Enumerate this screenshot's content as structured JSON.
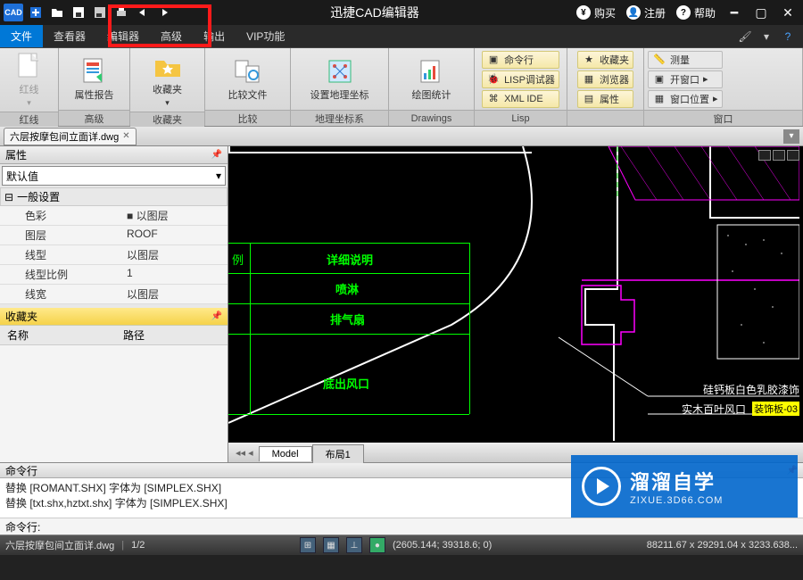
{
  "titlebar": {
    "logo": "CAD",
    "title": "迅捷CAD编辑器",
    "buy": "购买",
    "register": "注册",
    "help": "帮助"
  },
  "menu": {
    "tabs": [
      "文件",
      "查看器",
      "编辑器",
      "高级",
      "输出",
      "VIP功能"
    ]
  },
  "ribbon": {
    "g0": {
      "big": "红线",
      "drop": "红线",
      "label": "红线"
    },
    "g1": {
      "big": "属性报告",
      "label": "高级"
    },
    "g2": {
      "big": "收藏夹",
      "label": "收藏夹"
    },
    "g3": {
      "big": "比较文件",
      "label": "比较"
    },
    "g4": {
      "big": "设置地理坐标",
      "label": "地理坐标系"
    },
    "g5": {
      "big": "绘图统计",
      "label": "Drawings"
    },
    "g6": {
      "s0": "命令行",
      "s1": "LISP调试器",
      "s2": "XML IDE",
      "label": "Lisp"
    },
    "g7": {
      "s0": "收藏夹",
      "s1": "浏览器",
      "s2": "属性",
      "label": ""
    },
    "g8": {
      "s0": "测量",
      "s1": "开窗口",
      "s2": "窗口位置",
      "label": "窗口"
    }
  },
  "doc": {
    "name": "六层按摩包间立面详.dwg"
  },
  "props": {
    "title": "属性",
    "combo": "默认值",
    "section": "一般设置",
    "rows": [
      {
        "k": "色彩",
        "v": "■ 以图层"
      },
      {
        "k": "图层",
        "v": "ROOF"
      },
      {
        "k": "线型",
        "v": "以图层"
      },
      {
        "k": "线型比例",
        "v": "1"
      },
      {
        "k": "线宽",
        "v": "以图层"
      }
    ]
  },
  "fav": {
    "title": "收藏夹",
    "col0": "名称",
    "col1": "路径"
  },
  "canvas": {
    "col_hdr": "例",
    "col_desc": "详细说明",
    "r1": "喷淋",
    "r2": "排气扇",
    "r3": "底出风口",
    "note1": "硅钙板白色乳胶漆饰",
    "note2": "实木百叶风口",
    "note3": "装饰板-03",
    "btab0": "Model",
    "btab1": "布局1"
  },
  "cmd": {
    "title": "命令行",
    "l0": "替换 [ROMANT.SHX] 字体为 [SIMPLEX.SHX]",
    "l1": "替换 [txt.shx,hztxt.shx] 字体为 [SIMPLEX.SHX]",
    "prompt": "命令行:"
  },
  "status": {
    "file": "六层按摩包间立面详.dwg",
    "page": "1/2",
    "coords": "(2605.144; 39318.6; 0)",
    "ext": "88211.67 x 29291.04 x 3233.638..."
  },
  "watermark": {
    "big": "溜溜自学",
    "small": "ZIXUE.3D66.COM"
  }
}
